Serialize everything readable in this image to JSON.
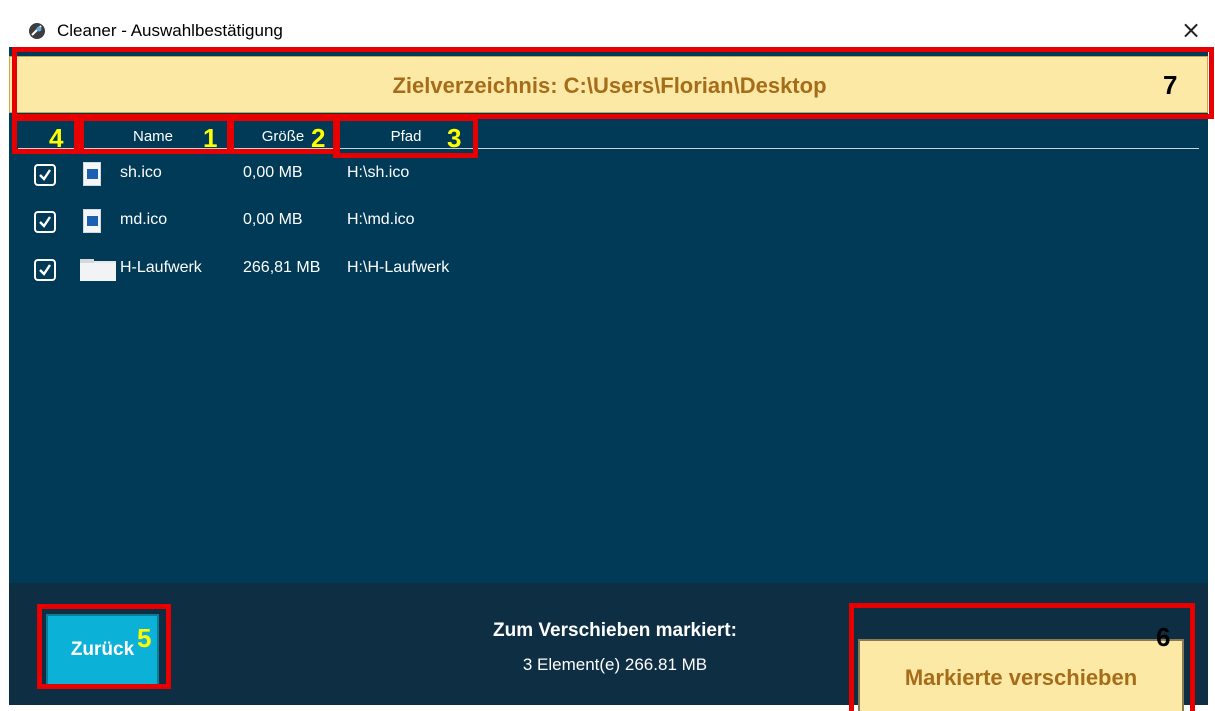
{
  "window": {
    "title": "Cleaner - Auswahlbestätigung",
    "close_glyph": "×"
  },
  "header": {
    "target_dir": "Zielverzeichnis: C:\\Users\\Florian\\Desktop"
  },
  "columns": {
    "name": "Name",
    "size": "Größe",
    "path": "Pfad"
  },
  "rows": [
    {
      "checked": true,
      "icon": "image-file-icon",
      "name": "sh.ico",
      "size": "0,00 MB",
      "path": "H:\\sh.ico"
    },
    {
      "checked": true,
      "icon": "image-file-icon",
      "name": "md.ico",
      "size": "0,00 MB",
      "path": "H:\\md.ico"
    },
    {
      "checked": true,
      "icon": "folder-icon",
      "name": "H-Laufwerk",
      "size": "266,81 MB",
      "path": "H:\\H-Laufwerk"
    }
  ],
  "footer": {
    "back_label": "Zurück",
    "summary_title": "Zum Verschieben markiert:",
    "summary_count": "3 Element(e)   266.81 MB",
    "move_label": "Markierte verschieben"
  },
  "annotations": {
    "n1": "1",
    "n2": "2",
    "n3": "3",
    "n4": "4",
    "n5": "5",
    "n6": "6",
    "n7": "7"
  },
  "colors": {
    "background": "#003a57",
    "header_bg": "#fde9a6",
    "header_text": "#a56d1a",
    "back_button": "#0bb1d6",
    "annotation": "#e80000"
  }
}
